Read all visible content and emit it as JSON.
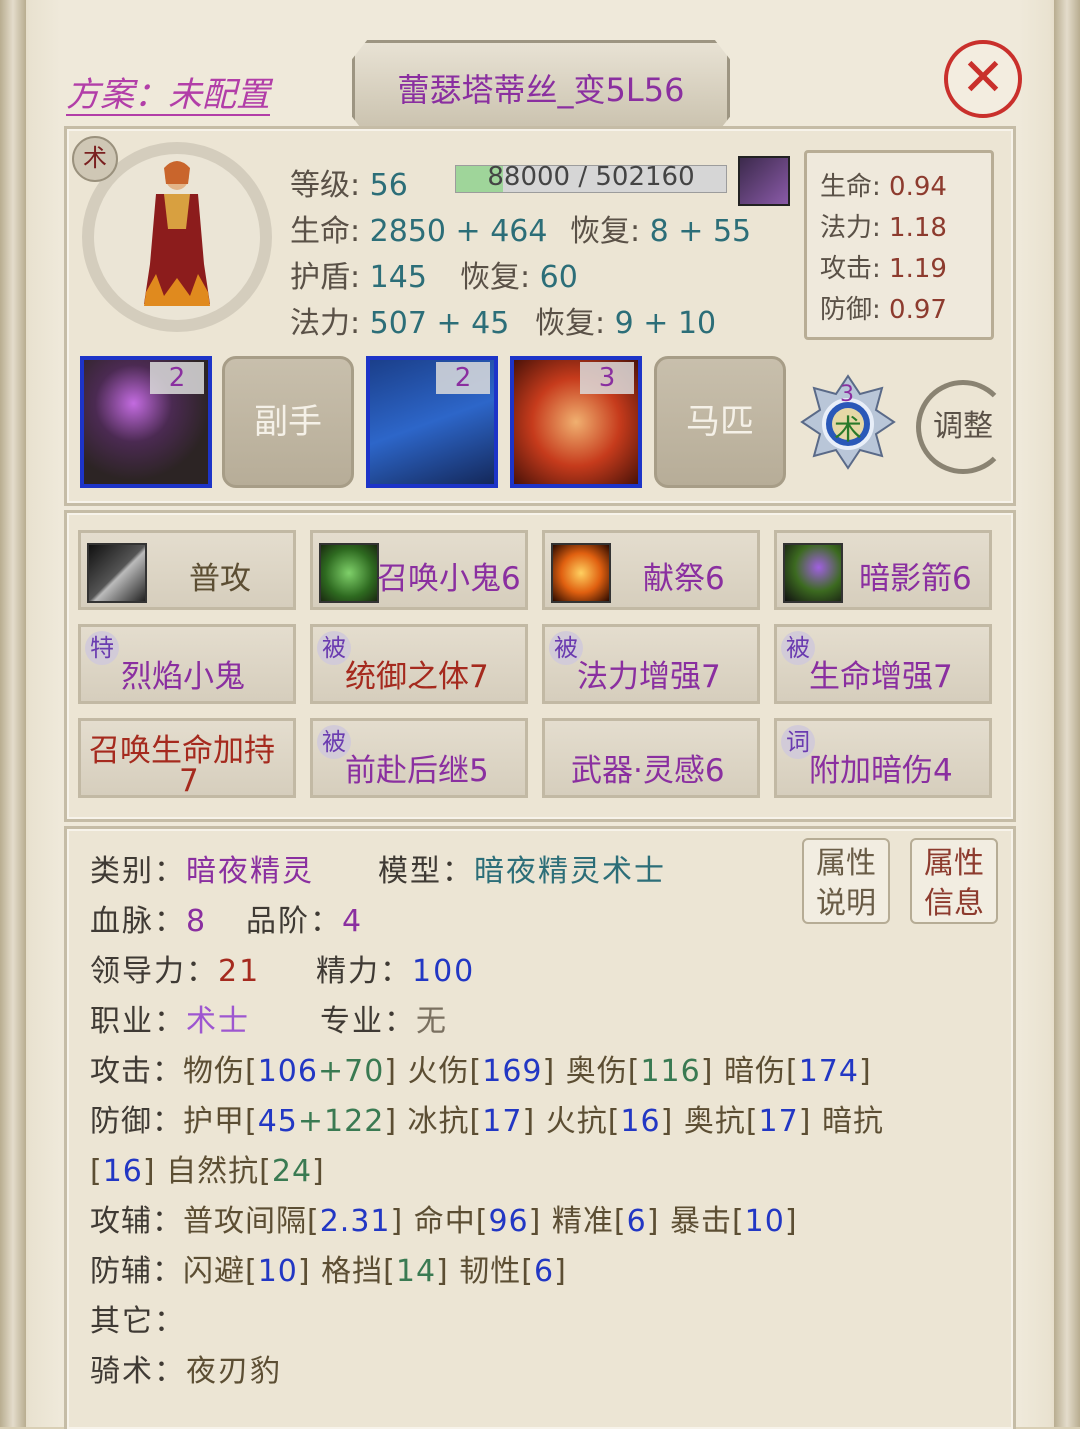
{
  "header": {
    "scheme_label": "方案：未配置",
    "character_name": "蕾瑟塔蒂丝_变5L56",
    "close_icon": "close-icon"
  },
  "profile": {
    "class_badge": "术",
    "level_label": "等级:",
    "level_value": "56",
    "exp_text": "88000 / 502160",
    "exp_progress": 0.175,
    "life_label": "生命:",
    "life_value": "2850 + 464",
    "life_regen_label": "恢复:",
    "life_regen_value": "8 + 55",
    "shield_label": "护盾:",
    "shield_value": "145",
    "shield_regen_label": "恢复:",
    "shield_regen_value": "60",
    "mana_label": "法力:",
    "mana_value": "507 + 45",
    "mana_regen_label": "恢复:",
    "mana_regen_value": "9 + 10"
  },
  "ratios": [
    {
      "label": "生命:",
      "value": "0.94"
    },
    {
      "label": "法力:",
      "value": "1.18"
    },
    {
      "label": "攻击:",
      "value": "1.19"
    },
    {
      "label": "防御:",
      "value": "0.97"
    }
  ],
  "equipment": {
    "slot1_count": "2",
    "slot2_label": "副手",
    "slot3_count": "2",
    "slot4_count": "3",
    "slot5_label": "马匹",
    "rank_number": "3",
    "rank_char": "术",
    "adjust_label": "调整"
  },
  "skills": {
    "s1": "普攻",
    "s2": "召唤小鬼6",
    "s3": "献祭6",
    "s4": "暗影箭6",
    "s5_tag": "特",
    "s5": "烈焰小鬼",
    "s6_tag": "被",
    "s6": "统御之体7",
    "s7_tag": "被",
    "s7": "法力增强7",
    "s8_tag": "被",
    "s8": "生命增强7",
    "s9_line1": "召唤生命加持",
    "s9_line2": "7",
    "s10_tag": "被",
    "s10": "前赴后继5",
    "s11": "武器·灵感6",
    "s12_tag": "词",
    "s12": "附加暗伤4"
  },
  "attributes": {
    "category_label": "类别：",
    "category_value": "暗夜精灵",
    "model_label": "模型：",
    "model_value": "暗夜精灵术士",
    "bloodline_label": "血脉：",
    "bloodline_value": "8",
    "grade_label": "品阶：",
    "grade_value": "4",
    "leadership_label": "领导力：",
    "leadership_value": "21",
    "energy_label": "精力：",
    "energy_value": "100",
    "job_label": "职业：",
    "job_value": "术士",
    "profession_label": "专业：",
    "profession_value": "无",
    "attack_label": "攻击：",
    "phys_label": "物伤[",
    "phys_base": "106",
    "phys_bonus": "+70",
    "fire_label": "] 火伤[",
    "fire_value": "169",
    "arcane_label": "] 奥伤[",
    "arcane_value": "116",
    "shadow_label": "] 暗伤[",
    "shadow_value": "174",
    "close_bracket": "]",
    "defense_label": "防御：",
    "armor_label": "护甲[",
    "armor_base": "45",
    "armor_bonus": "+122",
    "ice_label": "] 冰抗[",
    "ice_value": "17",
    "fireres_label": "] 火抗[",
    "fireres_value": "16",
    "arcaneres_label": "] 奥抗[",
    "arcaneres_value": "17",
    "shadowres_label": "] 暗抗",
    "shadowres_open": "[",
    "shadowres_value": "16",
    "nature_label": "] 自然抗[",
    "nature_value": "24",
    "atk_aux_label": "攻辅：",
    "interval_label": "普攻间隔[",
    "interval_value": "2.31",
    "hit_label": "] 命中[",
    "hit_value": "96",
    "precision_label": "] 精准[",
    "precision_value": "6",
    "crit_label": "] 暴击[",
    "crit_value": "10",
    "def_aux_label": "防辅：",
    "dodge_label": "闪避[",
    "dodge_value": "10",
    "block_label": "] 格挡[",
    "block_value": "14",
    "tough_label": "] 韧性[",
    "tough_value": "6",
    "other_label": "其它：",
    "riding_label": "骑术：",
    "riding_value": "夜刃豹",
    "btn1_line1": "属性",
    "btn1_line2": "说明",
    "btn2_line1": "属性",
    "btn2_line2": "信息"
  }
}
